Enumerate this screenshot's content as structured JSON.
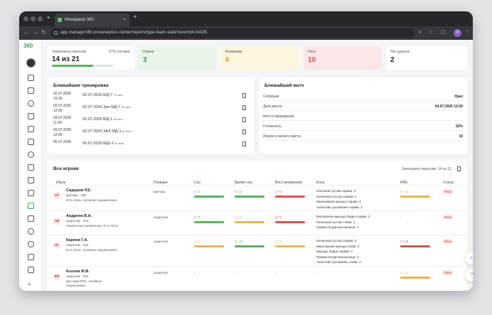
{
  "browser": {
    "tab_title": "Менеджер 360",
    "tab_close": "×",
    "new_tab": "+",
    "url": "app.manager360.pro/analytics-center/reports/type-team-state?eventId=10435",
    "user_initial": "V"
  },
  "sidebar": {
    "logo": "360"
  },
  "summary": {
    "filled_label": "Заполнили опросник",
    "percent_label": "67% состава",
    "filled_value": "14 из 21",
    "progress": 0.67,
    "norm": {
      "label": "Норма",
      "value": "3"
    },
    "attention": {
      "label": "Внимание",
      "value": "6"
    },
    "risk": {
      "label": "Риск",
      "value": "10"
    },
    "nodata": {
      "label": "Нет данных",
      "value": "2"
    }
  },
  "trainings": {
    "title": "Ближайшие тренировки",
    "items": [
      {
        "date": "02.07.2026",
        "time": "10:30",
        "title": "02.07.2026 МД-7",
        "dur": "70 мин"
      },
      {
        "date": "02.07.2026",
        "time": "12:00",
        "title": "02.07.2026 Зал МД-7",
        "dur": "90 мин"
      },
      {
        "date": "03.07.2026",
        "time": "11:00",
        "title": "03.07.2026 МД-1",
        "dur": "55 мин"
      },
      {
        "date": "03.07.2026",
        "time": "12:00",
        "title": "03.07.2026 ЗАЛ МД-1",
        "dur": "60 мин"
      },
      {
        "date": "05.07.2026",
        "time": "",
        "title": "05.07.2026 МД+1",
        "dur": "60 мин"
      }
    ]
  },
  "match": {
    "title": "Ближайший матч",
    "rows": [
      {
        "label": "Соперник",
        "value": "Урал"
      },
      {
        "label": "Дата матча",
        "value": "04.07.2026 12:00"
      },
      {
        "label": "Место проведения",
        "value": ""
      },
      {
        "label": "Готовность",
        "value": "52%"
      },
      {
        "label": "Игроки в риске к матчу",
        "value": "10"
      }
    ]
  },
  "players": {
    "title": "Все игроки",
    "filled_note": "Заполнили опросник: 14 из 21",
    "columns": {
      "player": "Игрок",
      "position": "Позиция",
      "sleep": "Сон",
      "sleep_time": "Время сна",
      "recovery": "Восстановление",
      "pain": "Боль",
      "rpe": "RPE",
      "status": "Статус"
    },
    "rows": [
      {
        "initials": "СР",
        "name": "Сидоров Р.Е.",
        "num": "вратарь · #99",
        "note": "Есть боль. Активное недомогание",
        "note2": "",
        "position": "вратарь",
        "sleep": "4 / 5",
        "sleep_time": "9 / 10",
        "recovery": "2 / 5",
        "pain": [
          "Локтевой сустав справа: 2",
          "Коленный сустав справа: 2",
          "Икроножная мышца справа: 2",
          "Ахиллово сухожилие справа: 2"
        ],
        "rpe": "5 / 10",
        "status": "Риск"
      },
      {
        "initials": "АВ",
        "name": "Андреев В.А.",
        "num": "защитник · #44",
        "note": "Низкое восстановление. Есть боль",
        "note2": "",
        "position": "защитник",
        "sleep": "4 / 5",
        "sleep_time": "5 / 10",
        "recovery": "2 / 5",
        "pain": [
          "Внутренняя мышца бедра справа: 2",
          "Коленный сустав слева: 1",
          "Правая ягодичная мышца: 1"
        ],
        "rpe": "-",
        "status": "Риск"
      },
      {
        "initials": "КГ",
        "name": "Карпов Г.А.",
        "num": "защитник · #33",
        "note": "Есть боль. Активное недомогание",
        "note2": "",
        "position": "защитник",
        "sleep": "3 / 5",
        "sleep_time": "8 / 10",
        "recovery": "3 / 5",
        "pain": [
          "Коленный сустав справа: 2",
          "Икроножная мышца слева: 2",
          "Мышцы бедра справа: 2",
          "Правая ягодичная мышца: 1",
          "Ахиллово сухожилие слева: 1"
        ],
        "rpe": "4 / 10",
        "status": "Риск"
      },
      {
        "initials": "КФ",
        "name": "Козлов Ф.В.",
        "num": "защитник · #55",
        "note": "Высокий RPE. Активное",
        "note2": "недомогание",
        "position": "защитник",
        "sleep": "-",
        "sleep_time": "-",
        "recovery": "-",
        "pain": [
          "-"
        ],
        "rpe": "6 / 10",
        "status": "Риск"
      }
    ]
  },
  "colors": {
    "green": "#59b261",
    "yellow": "#e6b84a",
    "red": "#d9534f",
    "risk": "#c0392b"
  }
}
